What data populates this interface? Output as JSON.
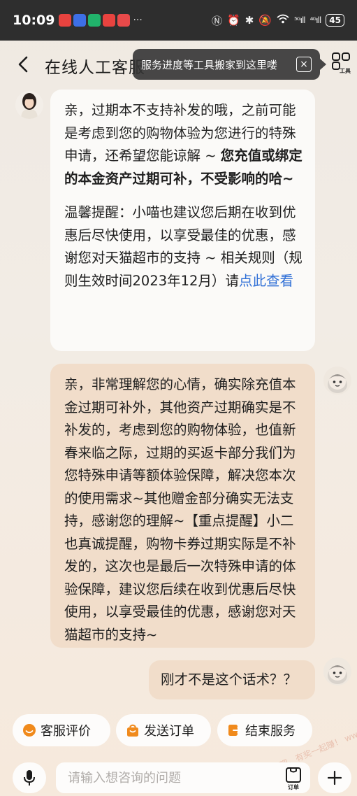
{
  "status_bar": {
    "time": "10:09",
    "more": "···",
    "signal1": "⁵ᴳıll",
    "signal2": "⁴ᴳıll",
    "battery": "45"
  },
  "header": {
    "title": "在线人工客服",
    "tooltip": "服务进度等工具搬家到这里喽",
    "tooltip_close": "×",
    "tools_label": "工具"
  },
  "messages": {
    "agent": {
      "para1_normal": "亲，过期本不支持补发的哦，之前可能是考虑到您的购物体验为您进行的特殊申请，还希望您能谅解 ~ ",
      "para1_bold": "您充值或绑定的本金资产过期可补，不受影响的哈~",
      "para2": "温馨提醒：小喵也建议您后期在收到优惠后尽快使用，以享受最佳的优惠，感谢您对天猫超市的支持 ~ 相关规则（规则生效时间2023年12月）请",
      "link": "点此查看"
    },
    "user1": "亲，非常理解您的心情，确实除充值本金过期可补外，其他资产过期确实是不补发的，考虑到您的购物体验，也值新春来临之际，过期的买返卡部分我们为您特殊申请等额体验保障，解决您本次的使用需求~其他赠金部分确实无法支持，感谢您的理解~【重点提醒】小二也真诚提醒，购物卡券过期实际是不补发的，这次也是最后一次特殊申请的体验保障，建议您后续在收到优惠后尽快使用，以享受最佳的优惠，感谢您对天猫超市的支持~",
    "user2": "刚才不是这个话术？？"
  },
  "quick_actions": [
    {
      "label": "客服评价",
      "icon": "smile-icon",
      "color": "#f08a1c"
    },
    {
      "label": "发送订单",
      "icon": "bag-icon",
      "color": "#f08a1c"
    },
    {
      "label": "结束服务",
      "icon": "exit-icon",
      "color": "#f08a1c"
    }
  ],
  "input": {
    "placeholder": "请输入想咨询的问题",
    "order_label": "订单"
  },
  "watermark": "赚客吧，有奖一起赚！ www.zuanke8.com",
  "colors": {
    "user_bubble": "#f1ddca",
    "agent_bubble": "#fbfaf8",
    "link": "#2f6fd6",
    "accent": "#f08a1c"
  }
}
